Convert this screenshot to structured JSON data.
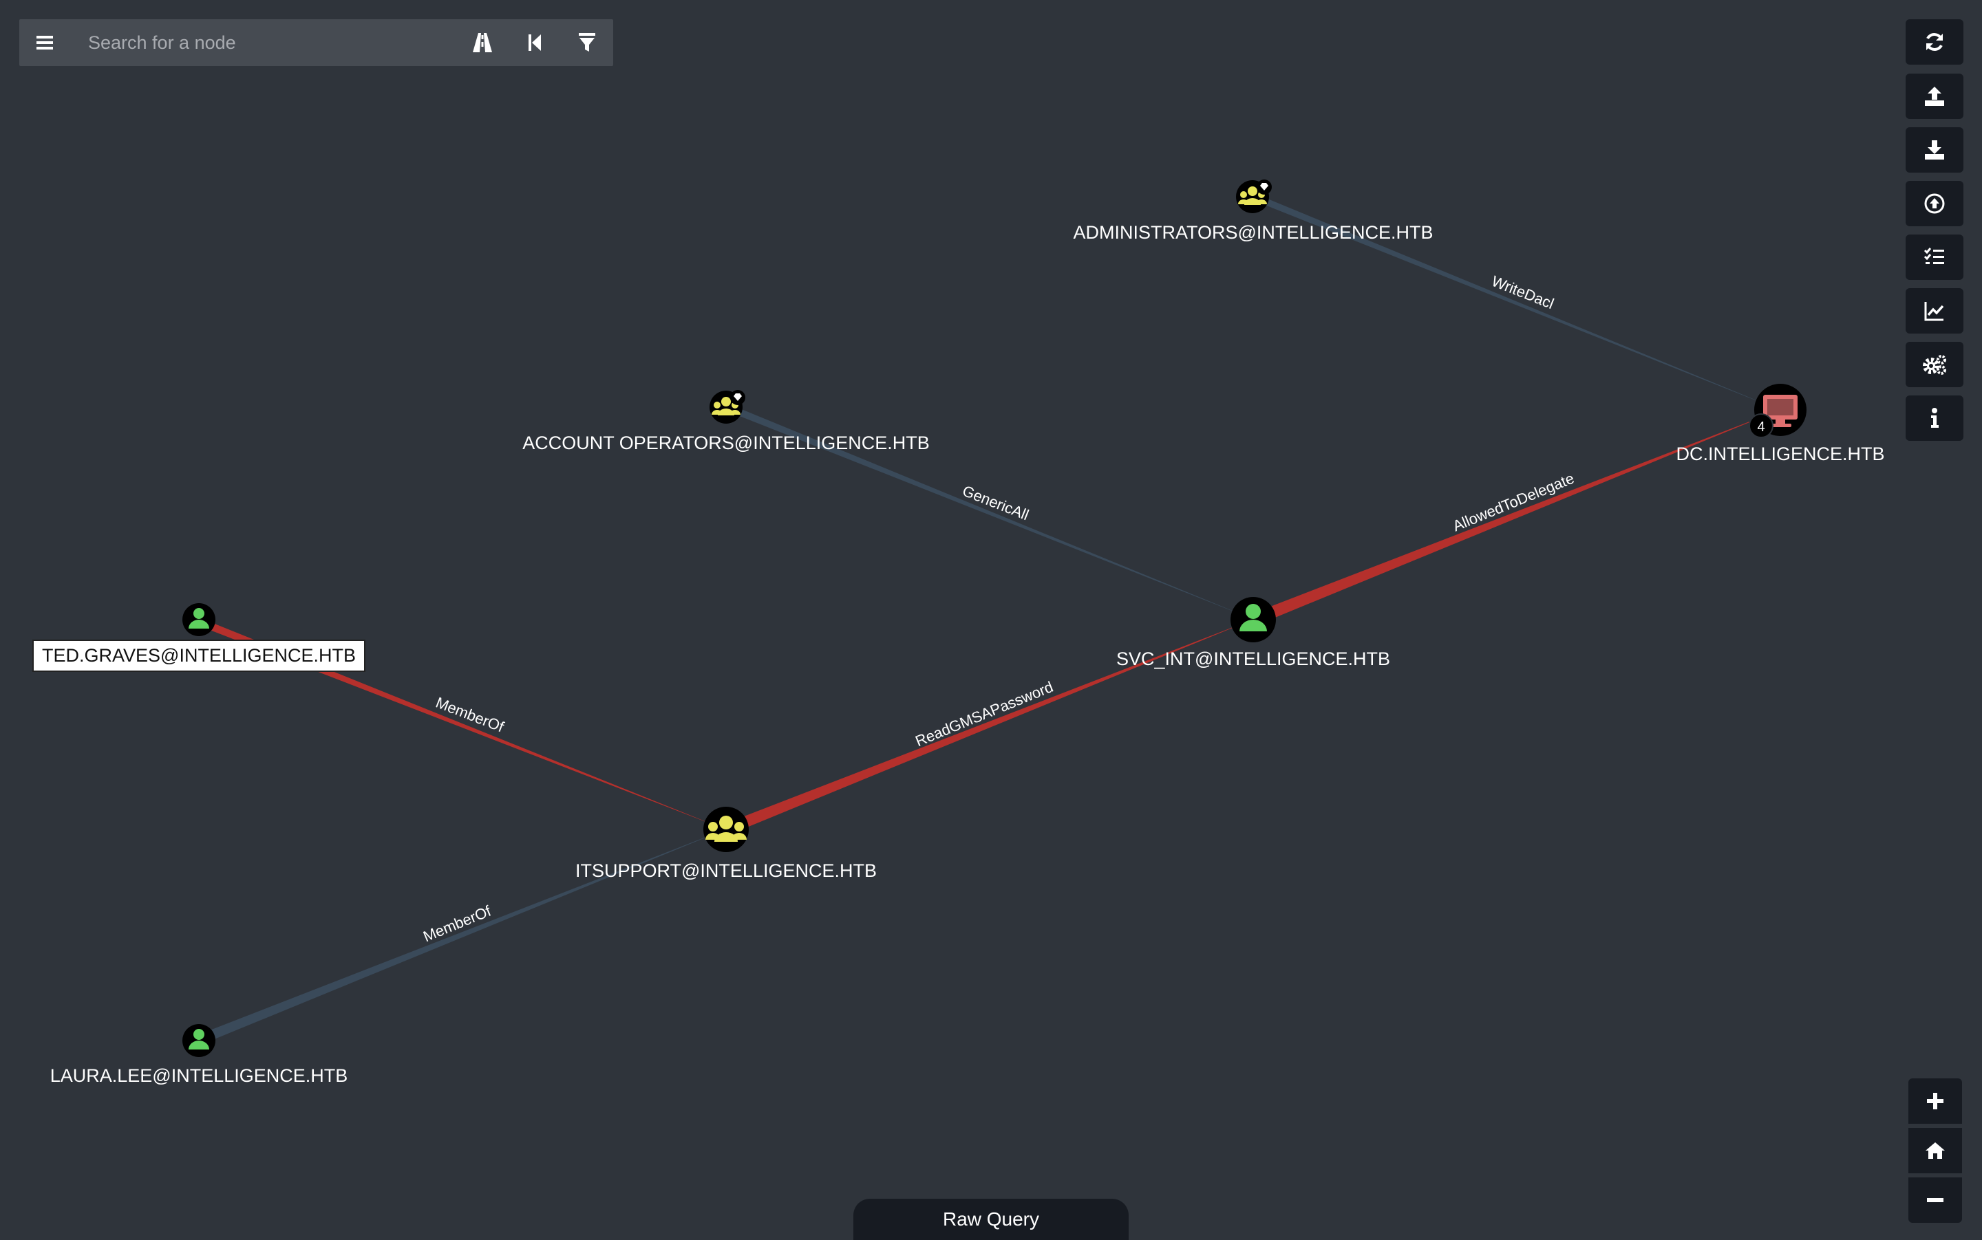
{
  "search": {
    "placeholder": "Search for a node"
  },
  "toolbar_icons": {
    "menu": "hamburger-icon",
    "pathfinding": "road-icon",
    "back": "step-backward-icon",
    "filter": "filter-icon"
  },
  "right_toolbar": [
    {
      "icon": "refresh-icon"
    },
    {
      "icon": "upload-icon"
    },
    {
      "icon": "download-icon"
    },
    {
      "icon": "import-icon"
    },
    {
      "icon": "queries-list-icon"
    },
    {
      "icon": "chart-icon"
    },
    {
      "icon": "settings-icon"
    },
    {
      "icon": "info-icon"
    }
  ],
  "zoom": {
    "in": "plus-icon",
    "home": "home-icon",
    "out": "minus-icon"
  },
  "nodes": {
    "administrators": {
      "label": "ADMINISTRATORS@INTELLIGENCE.HTB",
      "type": "group-highvalue"
    },
    "account_operators": {
      "label": "ACCOUNT OPERATORS@INTELLIGENCE.HTB",
      "type": "group-highvalue"
    },
    "dc": {
      "label": "DC.INTELLIGENCE.HTB",
      "type": "computer",
      "badge": "4"
    },
    "ted": {
      "label": "TED.GRAVES@INTELLIGENCE.HTB",
      "type": "user"
    },
    "svc_int": {
      "label": "SVC_INT@INTELLIGENCE.HTB",
      "type": "user"
    },
    "itsupport": {
      "label": "ITSUPPORT@INTELLIGENCE.HTB",
      "type": "group"
    },
    "laura": {
      "label": "LAURA.LEE@INTELLIGENCE.HTB",
      "type": "user"
    }
  },
  "edges": {
    "writedacl": "WriteDacl",
    "genericall": "GenericAll",
    "allowedtodelegate": "AllowedToDelegate",
    "memberof_ted": "MemberOf",
    "readgmsa": "ReadGMSAPassword",
    "memberof_laura": "MemberOf"
  },
  "colors": {
    "path_edge": "#b5302c",
    "normal_edge": "#3a4a5a",
    "user": "#5fd05f",
    "group": "#e8e45a",
    "computer": "#e07070"
  },
  "raw_query": {
    "label": "Raw Query"
  }
}
